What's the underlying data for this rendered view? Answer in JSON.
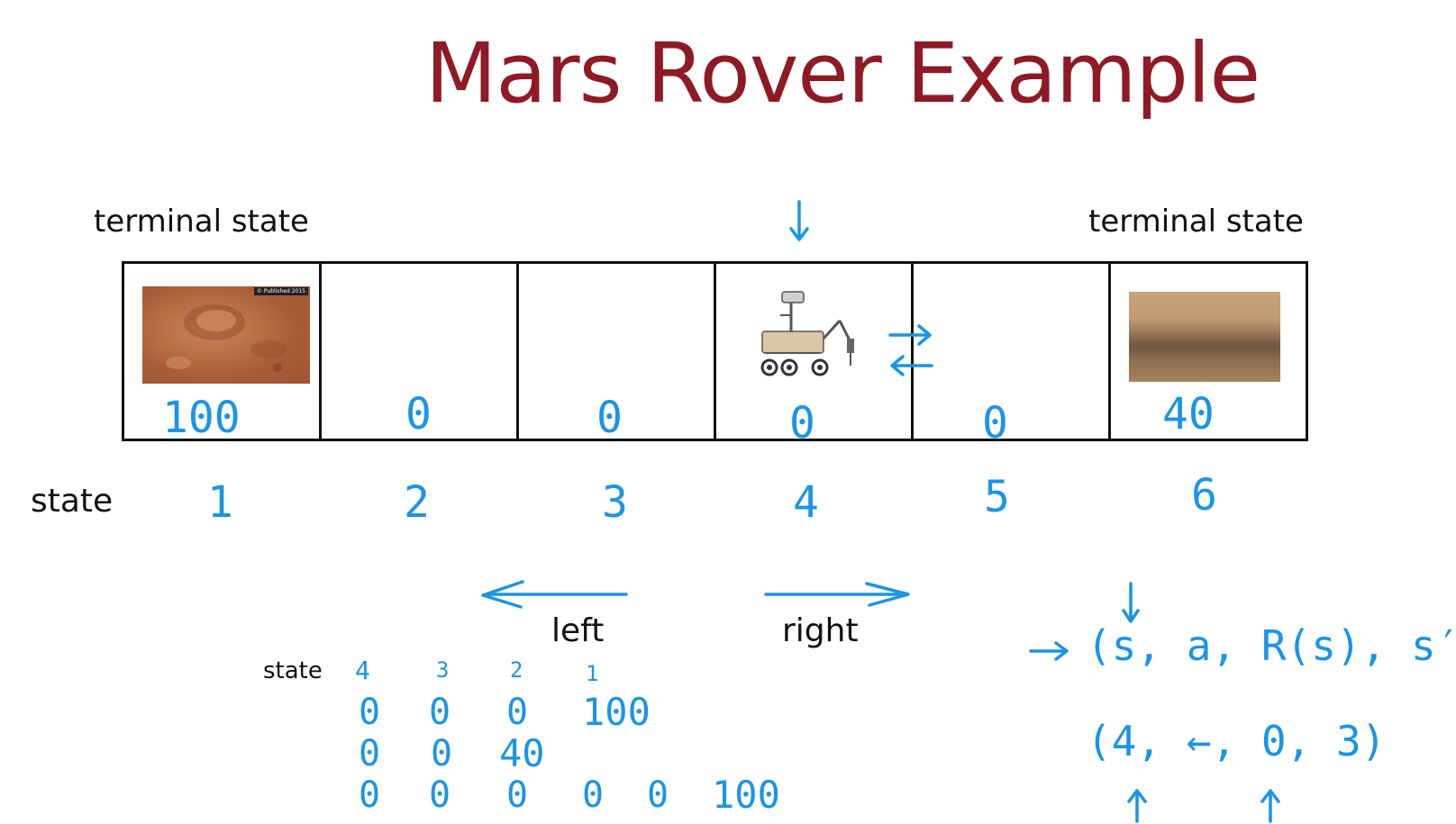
{
  "title": "Mars Rover Example",
  "labels": {
    "terminal_left": "terminal state",
    "terminal_right": "terminal state",
    "state_row": "state",
    "left": "left",
    "right": "right",
    "table_state": "state"
  },
  "cells": [
    {
      "reward": "100",
      "state": "1"
    },
    {
      "reward": "0",
      "state": "2"
    },
    {
      "reward": "0",
      "state": "3"
    },
    {
      "reward": "0",
      "state": "4"
    },
    {
      "reward": "0",
      "state": "5"
    },
    {
      "reward": "40",
      "state": "6"
    }
  ],
  "images": {
    "crater_watermark": "© Published 2015"
  },
  "table": {
    "header": [
      "4",
      "3",
      "2",
      "1"
    ],
    "row1": [
      "0",
      "0",
      "0",
      "100"
    ],
    "row2": [
      "0",
      "0",
      "40"
    ],
    "row3": [
      "0",
      "0",
      "0",
      "0",
      "0",
      "100"
    ]
  },
  "tuple": {
    "general": "(s, a, R(s), s′)",
    "example": "(4, ←, 0, 3)"
  },
  "colors": {
    "title": "#8f1a24",
    "annotation": "#1a94e6"
  }
}
